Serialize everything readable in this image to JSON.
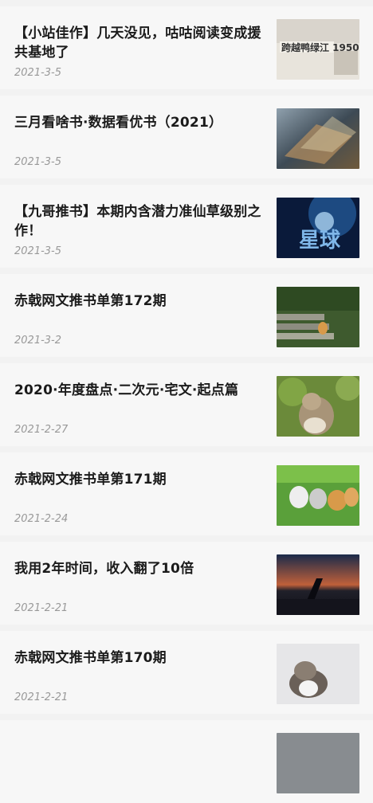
{
  "articles": [
    {
      "title": "【小站佳作】几天没见，咕咕阅读变成援共基地了",
      "date": "2021-3-5",
      "thumb": "book-cover-1950-thumbnail",
      "thumb_text": "跨越鸭绿江 1950"
    },
    {
      "title": "三月看啥书·数据看优书（2021）",
      "date": "2021-3-5",
      "thumb": "fantasy-battle-thumbnail"
    },
    {
      "title": "【九哥推书】本期内含潜力准仙草级别之作！",
      "date": "2021-3-5",
      "thumb": "starry-cover-thumbnail",
      "thumb_text": "星球"
    },
    {
      "title": "赤戟网文推书单第172期",
      "date": "2021-3-2",
      "thumb": "cat-on-stairs-thumbnail"
    },
    {
      "title": "2020·年度盘点·二次元·宅文·起点篇",
      "date": "2021-2-27",
      "thumb": "squirrel-thumbnail"
    },
    {
      "title": "赤戟网文推书单第171期",
      "date": "2021-2-24",
      "thumb": "kittens-on-grass-thumbnail"
    },
    {
      "title": "我用2年时间，收入翻了10倍",
      "date": "2021-2-21",
      "thumb": "airplane-wing-sunset-thumbnail"
    },
    {
      "title": "赤戟网文推书单第170期",
      "date": "2021-2-21",
      "thumb": "tabby-cat-thumbnail"
    }
  ]
}
